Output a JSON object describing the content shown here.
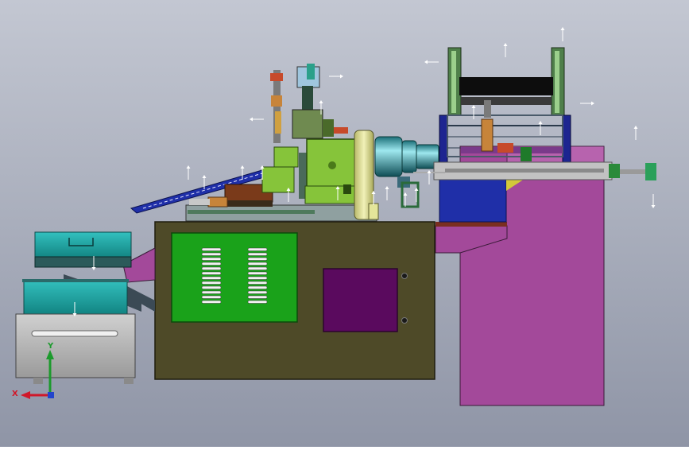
{
  "viewport": {
    "background_top": "#c3c7d2",
    "background_bottom": "#8f95a6"
  },
  "triad": {
    "x_label": "X",
    "y_label": "Y",
    "x_color": "#d0182a",
    "y_color": "#1c9a2c",
    "z_color": "#2244cc"
  },
  "colors": {
    "frame_olive": "#4e4a28",
    "panel_green": "#1aa21a",
    "door_purple": "#5a0a5e",
    "stand_magenta": "#a3499a",
    "tray_teal": "#1aa5a3",
    "drawer_gray": "#b1b1b1",
    "head_lime": "#86c43a",
    "pale_yellow": "#e4e59a",
    "body_blue": "#1f2fa8",
    "rail_gray": "#c2c2c2"
  }
}
